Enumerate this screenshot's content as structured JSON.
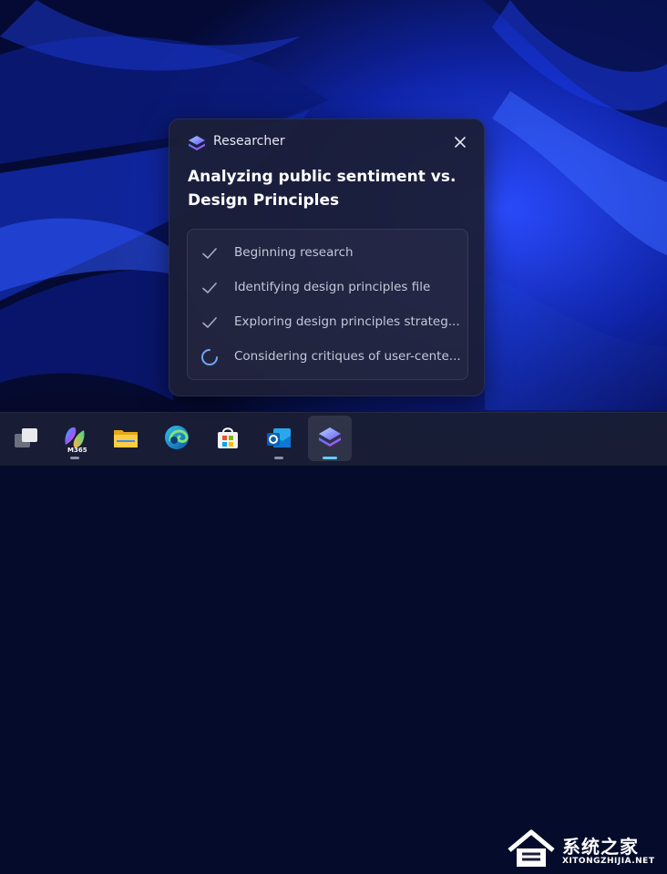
{
  "card": {
    "app_name": "Researcher",
    "heading_line1": "Analyzing public sentiment vs.",
    "heading_line2": "Design Principles",
    "steps": [
      {
        "label": "Beginning research",
        "status": "done"
      },
      {
        "label": "Identifying design principles file",
        "status": "done"
      },
      {
        "label": "Exploring design principles strateg...",
        "status": "done"
      },
      {
        "label": "Considering critiques of user-cente...",
        "status": "in-progress"
      }
    ]
  },
  "taskbar": {
    "m365_label": "M365",
    "items": [
      "task-view-icon",
      "microsoft-365-copilot-icon",
      "file-explorer-icon",
      "edge-icon",
      "microsoft-store-icon",
      "outlook-icon",
      "researcher-icon"
    ]
  },
  "watermark": {
    "title": "系统之家",
    "url": "XITONGZHIJIA.NET"
  },
  "colors": {
    "accent": "#60cdff",
    "card_bg": "#1b1f37",
    "wallpaper": "#0a1a8c"
  }
}
